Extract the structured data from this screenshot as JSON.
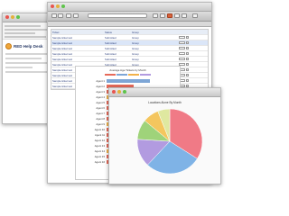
{
  "email": {
    "brand_text": "RED Help Desk"
  },
  "main": {
    "table_rows": [
      {
        "c1": "Ticket",
        "c2": "Status",
        "c3": "Group"
      },
      {
        "c1": "Sample ticket text",
        "c2": "Submitted",
        "c3": "Group"
      },
      {
        "c1": "Sample ticket text",
        "c2": "Submitted",
        "c3": "Group"
      },
      {
        "c1": "Sample ticket text",
        "c2": "Submitted",
        "c3": "Group"
      },
      {
        "c1": "Sample ticket text",
        "c2": "Submitted",
        "c3": "Group"
      },
      {
        "c1": "Sample ticket text",
        "c2": "Submitted",
        "c3": "Group"
      },
      {
        "c1": "Sample ticket text",
        "c2": "Submitted",
        "c3": "Group"
      },
      {
        "c1": "Sample ticket text",
        "c2": "Submitted",
        "c3": "Group"
      },
      {
        "c1": "Sample ticket text",
        "c2": "Submitted",
        "c3": "Group"
      },
      {
        "c1": "Sample ticket text",
        "c2": "Submitted",
        "c3": "Group"
      },
      {
        "c1": "Sample ticket text",
        "c2": "Submitted",
        "c3": "Group"
      },
      {
        "c1": "Sample ticket text",
        "c2": "Submitted",
        "c3": "Group"
      }
    ],
    "report_title": "Average Age Tickets by Month",
    "bar_labels": [
      "Agent 1",
      "Agent 2",
      "Agent 3",
      "Agent 4",
      "Agent 5",
      "Agent 6",
      "Agent 7",
      "Agent 8",
      "Agent 9",
      "Agent 10",
      "Agent 11",
      "Agent 12",
      "Agent 13",
      "Agent 14",
      "Agent 15",
      "Agent 16"
    ]
  },
  "pie": {
    "title": "Locations Alone By Month"
  },
  "colors": {
    "bar_main": "#e66a5a",
    "bar_alt": "#7ea6d6",
    "bar_accent": "#f2b24a",
    "pie": [
      "#f07a86",
      "#7fb3e6",
      "#b29be0",
      "#9fd37a",
      "#f4c65e",
      "#dfe8a0"
    ]
  }
}
